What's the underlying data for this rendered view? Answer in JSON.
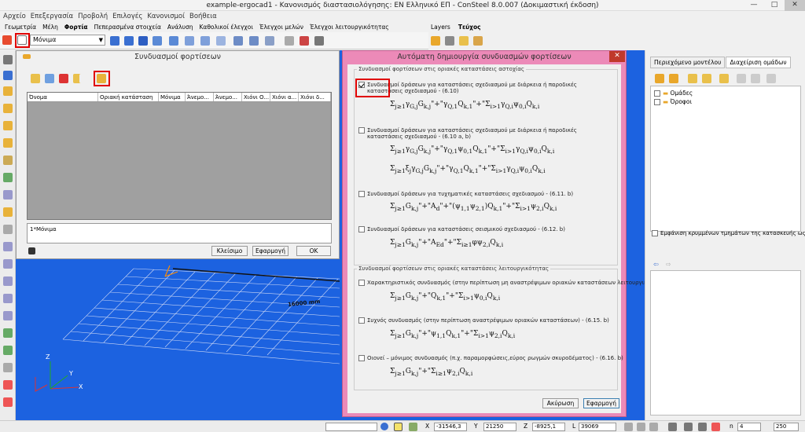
{
  "window": {
    "title": "example-ergocad1 - Κανονισμός διαστασιολόγησης: ΕΝ Ελληνικό ΕΠ - ConSteel 8.0.007 (Δοκιμαστική έκδοση)",
    "minimize": "—",
    "maximize": "□",
    "close": "✕"
  },
  "menu": [
    "Αρχείο",
    "Επεξεργασία",
    "Προβολή",
    "Επιλογές",
    "Κανονισμοί",
    "Βοήθεια"
  ],
  "ribbon_tabs": [
    "Γεωμετρία",
    "Μέλη",
    "Φορτία",
    "Πεπερασμένα στοιχεία",
    "Ανάλυση",
    "Καθολικοί έλεγχοι",
    "Έλεγχοι μελών",
    "Έλεγχοι λειτουργικότητας"
  ],
  "ribbon_tabs_right": [
    "Layers",
    "Τεύχος"
  ],
  "load_case_select": "Μόνιμα",
  "combinations_dialog": {
    "title": "Συνδυασμοί φορτίσεων",
    "columns": [
      "Όνομα",
      "Οριακή κατάσταση",
      "Μόνιμα",
      "Άνεμο...",
      "Άνεμο...",
      "Χιόνι Ο...",
      "Χιόνι α...",
      "Χιόνι δ..."
    ],
    "note": "1*Μόνιμα",
    "buttons": {
      "close": "Κλείσιμο",
      "apply": "Εφαρμογή",
      "ok": "OK"
    }
  },
  "auto_dialog": {
    "title": "Αυτόματη δημιουργία συνδυασμών φορτίσεων",
    "group1": "Συνδυασμοί φορτίσεων στις οριακές καταστάσεις αστοχίας",
    "group2": "Συνδυασμοί φορτίσεων στις οριακές καταστάσεις λειτουργικότητας",
    "options": [
      {
        "label": "Συνδυασμοί δράσεων για καταστάσεις σχεδιασμού με διάρκεια ή παροδικές καταστάσεις σχεδιασμού - (6.10)",
        "checked": true
      },
      {
        "label": "Συνδυασμοί δράσεων για καταστάσεις σχεδιασμού με διάρκεια ή παροδικές καταστάσεις σχεδιασμού - (6.10 a, b)",
        "checked": false
      },
      {
        "label": "Συνδυασμοί δράσεων για τυχηματικές καταστάσεις σχεδιασμού - (6.11. b)",
        "checked": false
      },
      {
        "label": "Συνδυασμοί δράσεων για καταστάσεις σεισμικού σχεδιασμού - (6.12. b)",
        "checked": false
      },
      {
        "label": "Χαρακτηριστικός συνδυασμός (στην περίπτωση μη αναστρέψιμων οριακών καταστάσεων λειτουργικότ",
        "checked": false
      },
      {
        "label": "Συχνός συνδυασμός (στην περίπτωση αναστρέψιμων οριακών καταστάσεων) - (6.15. b)",
        "checked": false
      },
      {
        "label": "Οιονεί – μόνιμος συνδυασμός (π.χ. παραμορφώσεις,εύρος ρωγμών σκυροδέματος) - (6.16. b)",
        "checked": false
      }
    ],
    "buttons": {
      "cancel": "Ακύρωση",
      "apply": "Εφαρμογή"
    }
  },
  "right_panel": {
    "tabs": [
      "Περιεχόμενο μοντέλου",
      "Διαχείριση ομάδων"
    ],
    "tree": [
      "Ομάδες",
      "Όροφοι"
    ],
    "checkbox_label": "Εμφάνιση κρυμμένων τμημάτων της κατασκευής ως διά"
  },
  "viewport": {
    "dimension_label": "16000 mm",
    "axes": [
      "Z",
      "Y",
      "X"
    ]
  },
  "status": {
    "x_label": "X",
    "x": "-31546,3",
    "y_label": "Y",
    "y": "21250",
    "z_label": "Z",
    "z": "-8925,1",
    "l_label": "L",
    "l": "39069",
    "n_label": "n",
    "n": "4",
    "last": "250"
  }
}
